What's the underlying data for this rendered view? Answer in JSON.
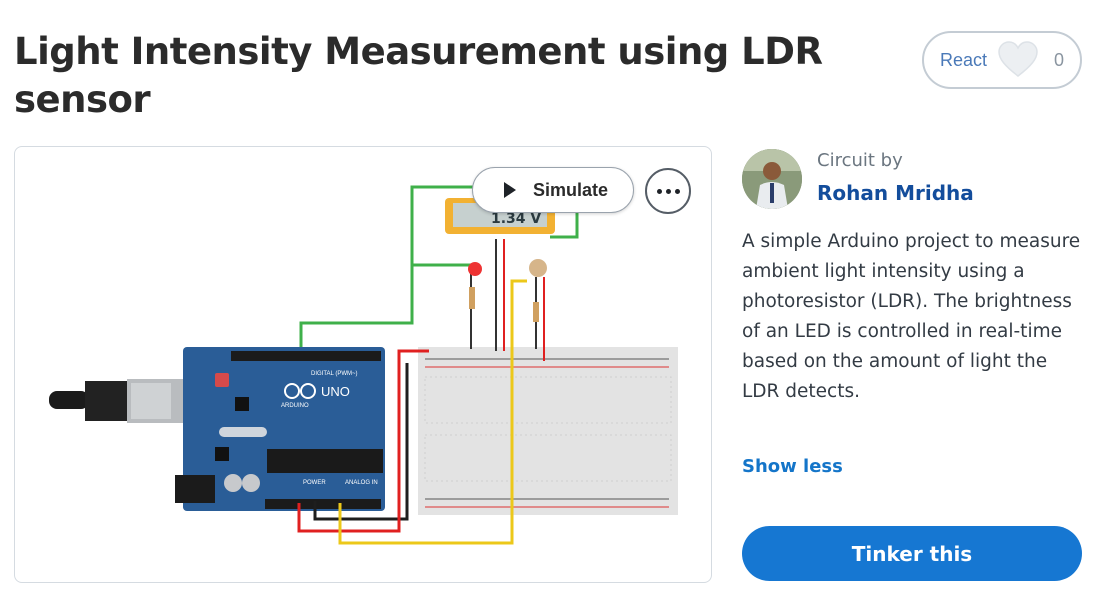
{
  "page": {
    "title": "Light Intensity Measurement using LDR sensor"
  },
  "react": {
    "label": "React",
    "count": "0",
    "icon": "heart-icon"
  },
  "preview": {
    "simulate_label": "Simulate",
    "more_icon": "more-options-icon",
    "multimeter_reading": "1.34 V",
    "board_labels": {
      "logo": "UNO",
      "brand": "ARDUINO",
      "digital": "DIGITAL (PWM~)",
      "power": "POWER",
      "analog": "ANALOG IN"
    }
  },
  "author": {
    "prefix": "Circuit by",
    "name": "Rohan Mridha"
  },
  "description": "A simple Arduino project to measure ambient light intensity using a photoresistor (LDR). The brightness of an LED is controlled in real-time based on the amount of light the LDR detects.",
  "actions": {
    "show_less": "Show less",
    "tinker": "Tinker this"
  },
  "colors": {
    "primary": "#1677d2",
    "link": "#134d9c",
    "board": "#2a5d97",
    "wire_green": "#3fb04a",
    "wire_red": "#e02020",
    "wire_yellow": "#ecc81a"
  }
}
